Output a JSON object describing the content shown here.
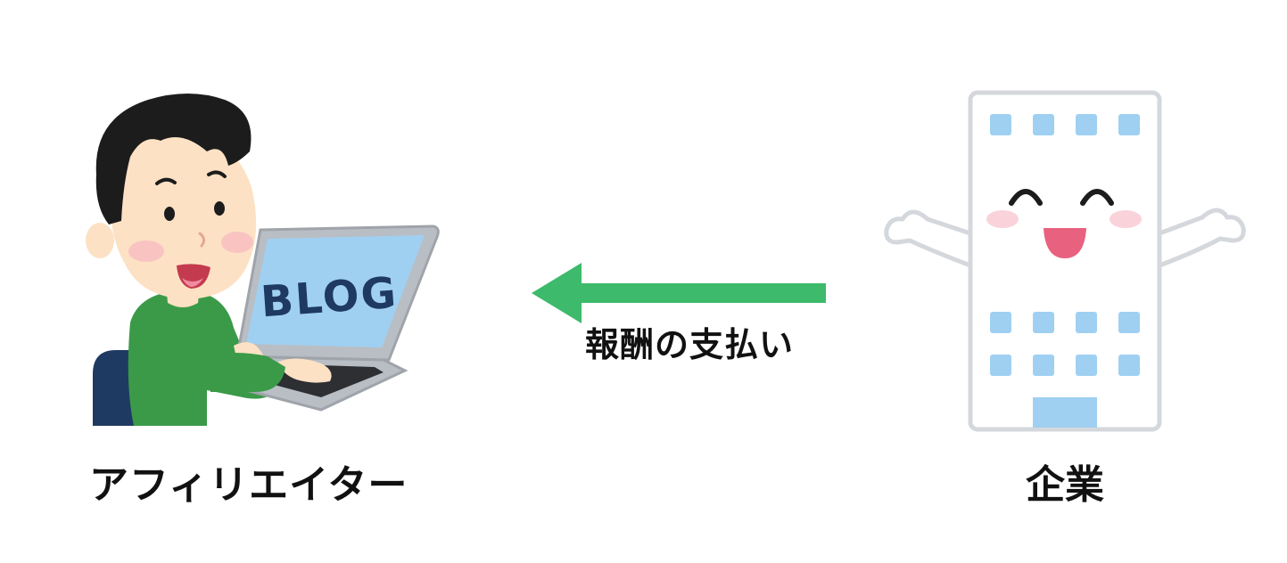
{
  "nodes": {
    "affiliate": {
      "label": "アフィリエイター",
      "screen_text": "BLOG"
    },
    "company": {
      "label": "企業"
    }
  },
  "edge": {
    "label": "報酬の支払い",
    "direction": "company-to-affiliate"
  },
  "colors": {
    "arrow": "#3dba6b",
    "hair": "#1c1c1c",
    "skin": "#fde1c4",
    "shirt": "#3a9a48",
    "chair": "#1f3a62",
    "laptop_body": "#b9bec4",
    "laptop_screen": "#9fd0f2",
    "building_window": "#9fd0f2",
    "building_outline": "#d4d8dc",
    "mouth": "#e8617e",
    "blush": "#f6b6c2"
  }
}
